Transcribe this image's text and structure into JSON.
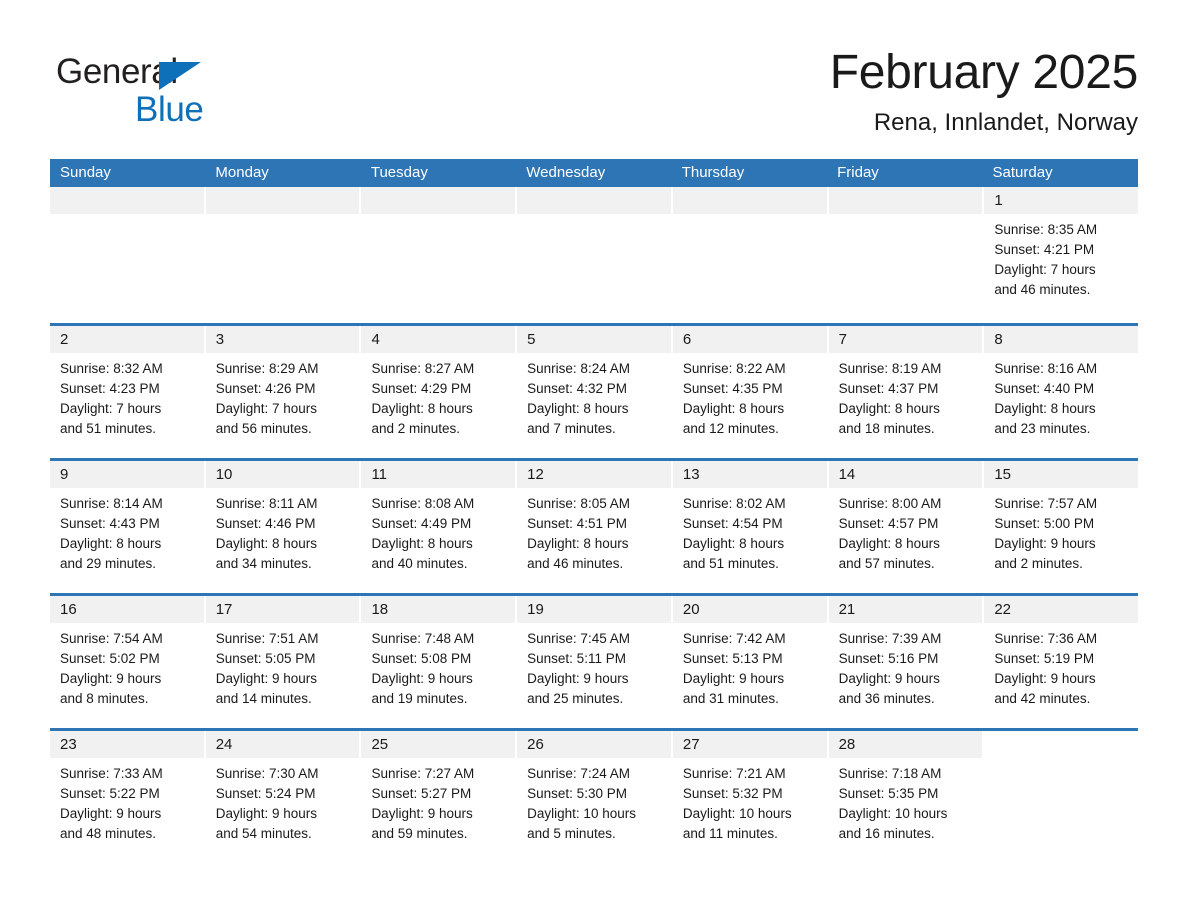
{
  "brand": {
    "name_part1": "General",
    "name_part2": "Blue",
    "flag_icon": "triangle-flag-icon",
    "accent_color": "#0d70b8"
  },
  "header": {
    "month_title": "February 2025",
    "location": "Rena, Innlandet, Norway"
  },
  "theme": {
    "header_blue": "#2e75b6",
    "daynum_strip": "#f1f1f1",
    "text": "#1a1a1a"
  },
  "weekdays": [
    "Sunday",
    "Monday",
    "Tuesday",
    "Wednesday",
    "Thursday",
    "Friday",
    "Saturday"
  ],
  "labels": {
    "sunrise": "Sunrise:",
    "sunset": "Sunset:",
    "daylight": "Daylight:"
  },
  "weeks": [
    {
      "days": [
        {
          "blank": true
        },
        {
          "blank": true
        },
        {
          "blank": true
        },
        {
          "blank": true
        },
        {
          "blank": true
        },
        {
          "blank": true
        },
        {
          "date": "1",
          "sunrise": "Sunrise: 8:35 AM",
          "sunset": "Sunset: 4:21 PM",
          "daylight_line1": "Daylight: 7 hours",
          "daylight_line2": "and 46 minutes."
        }
      ]
    },
    {
      "days": [
        {
          "date": "2",
          "sunrise": "Sunrise: 8:32 AM",
          "sunset": "Sunset: 4:23 PM",
          "daylight_line1": "Daylight: 7 hours",
          "daylight_line2": "and 51 minutes."
        },
        {
          "date": "3",
          "sunrise": "Sunrise: 8:29 AM",
          "sunset": "Sunset: 4:26 PM",
          "daylight_line1": "Daylight: 7 hours",
          "daylight_line2": "and 56 minutes."
        },
        {
          "date": "4",
          "sunrise": "Sunrise: 8:27 AM",
          "sunset": "Sunset: 4:29 PM",
          "daylight_line1": "Daylight: 8 hours",
          "daylight_line2": "and 2 minutes."
        },
        {
          "date": "5",
          "sunrise": "Sunrise: 8:24 AM",
          "sunset": "Sunset: 4:32 PM",
          "daylight_line1": "Daylight: 8 hours",
          "daylight_line2": "and 7 minutes."
        },
        {
          "date": "6",
          "sunrise": "Sunrise: 8:22 AM",
          "sunset": "Sunset: 4:35 PM",
          "daylight_line1": "Daylight: 8 hours",
          "daylight_line2": "and 12 minutes."
        },
        {
          "date": "7",
          "sunrise": "Sunrise: 8:19 AM",
          "sunset": "Sunset: 4:37 PM",
          "daylight_line1": "Daylight: 8 hours",
          "daylight_line2": "and 18 minutes."
        },
        {
          "date": "8",
          "sunrise": "Sunrise: 8:16 AM",
          "sunset": "Sunset: 4:40 PM",
          "daylight_line1": "Daylight: 8 hours",
          "daylight_line2": "and 23 minutes."
        }
      ]
    },
    {
      "days": [
        {
          "date": "9",
          "sunrise": "Sunrise: 8:14 AM",
          "sunset": "Sunset: 4:43 PM",
          "daylight_line1": "Daylight: 8 hours",
          "daylight_line2": "and 29 minutes."
        },
        {
          "date": "10",
          "sunrise": "Sunrise: 8:11 AM",
          "sunset": "Sunset: 4:46 PM",
          "daylight_line1": "Daylight: 8 hours",
          "daylight_line2": "and 34 minutes."
        },
        {
          "date": "11",
          "sunrise": "Sunrise: 8:08 AM",
          "sunset": "Sunset: 4:49 PM",
          "daylight_line1": "Daylight: 8 hours",
          "daylight_line2": "and 40 minutes."
        },
        {
          "date": "12",
          "sunrise": "Sunrise: 8:05 AM",
          "sunset": "Sunset: 4:51 PM",
          "daylight_line1": "Daylight: 8 hours",
          "daylight_line2": "and 46 minutes."
        },
        {
          "date": "13",
          "sunrise": "Sunrise: 8:02 AM",
          "sunset": "Sunset: 4:54 PM",
          "daylight_line1": "Daylight: 8 hours",
          "daylight_line2": "and 51 minutes."
        },
        {
          "date": "14",
          "sunrise": "Sunrise: 8:00 AM",
          "sunset": "Sunset: 4:57 PM",
          "daylight_line1": "Daylight: 8 hours",
          "daylight_line2": "and 57 minutes."
        },
        {
          "date": "15",
          "sunrise": "Sunrise: 7:57 AM",
          "sunset": "Sunset: 5:00 PM",
          "daylight_line1": "Daylight: 9 hours",
          "daylight_line2": "and 2 minutes."
        }
      ]
    },
    {
      "days": [
        {
          "date": "16",
          "sunrise": "Sunrise: 7:54 AM",
          "sunset": "Sunset: 5:02 PM",
          "daylight_line1": "Daylight: 9 hours",
          "daylight_line2": "and 8 minutes."
        },
        {
          "date": "17",
          "sunrise": "Sunrise: 7:51 AM",
          "sunset": "Sunset: 5:05 PM",
          "daylight_line1": "Daylight: 9 hours",
          "daylight_line2": "and 14 minutes."
        },
        {
          "date": "18",
          "sunrise": "Sunrise: 7:48 AM",
          "sunset": "Sunset: 5:08 PM",
          "daylight_line1": "Daylight: 9 hours",
          "daylight_line2": "and 19 minutes."
        },
        {
          "date": "19",
          "sunrise": "Sunrise: 7:45 AM",
          "sunset": "Sunset: 5:11 PM",
          "daylight_line1": "Daylight: 9 hours",
          "daylight_line2": "and 25 minutes."
        },
        {
          "date": "20",
          "sunrise": "Sunrise: 7:42 AM",
          "sunset": "Sunset: 5:13 PM",
          "daylight_line1": "Daylight: 9 hours",
          "daylight_line2": "and 31 minutes."
        },
        {
          "date": "21",
          "sunrise": "Sunrise: 7:39 AM",
          "sunset": "Sunset: 5:16 PM",
          "daylight_line1": "Daylight: 9 hours",
          "daylight_line2": "and 36 minutes."
        },
        {
          "date": "22",
          "sunrise": "Sunrise: 7:36 AM",
          "sunset": "Sunset: 5:19 PM",
          "daylight_line1": "Daylight: 9 hours",
          "daylight_line2": "and 42 minutes."
        }
      ]
    },
    {
      "days": [
        {
          "date": "23",
          "sunrise": "Sunrise: 7:33 AM",
          "sunset": "Sunset: 5:22 PM",
          "daylight_line1": "Daylight: 9 hours",
          "daylight_line2": "and 48 minutes."
        },
        {
          "date": "24",
          "sunrise": "Sunrise: 7:30 AM",
          "sunset": "Sunset: 5:24 PM",
          "daylight_line1": "Daylight: 9 hours",
          "daylight_line2": "and 54 minutes."
        },
        {
          "date": "25",
          "sunrise": "Sunrise: 7:27 AM",
          "sunset": "Sunset: 5:27 PM",
          "daylight_line1": "Daylight: 9 hours",
          "daylight_line2": "and 59 minutes."
        },
        {
          "date": "26",
          "sunrise": "Sunrise: 7:24 AM",
          "sunset": "Sunset: 5:30 PM",
          "daylight_line1": "Daylight: 10 hours",
          "daylight_line2": "and 5 minutes."
        },
        {
          "date": "27",
          "sunrise": "Sunrise: 7:21 AM",
          "sunset": "Sunset: 5:32 PM",
          "daylight_line1": "Daylight: 10 hours",
          "daylight_line2": "and 11 minutes."
        },
        {
          "date": "28",
          "sunrise": "Sunrise: 7:18 AM",
          "sunset": "Sunset: 5:35 PM",
          "daylight_line1": "Daylight: 10 hours",
          "daylight_line2": "and 16 minutes."
        },
        {
          "blank": true
        }
      ]
    }
  ]
}
